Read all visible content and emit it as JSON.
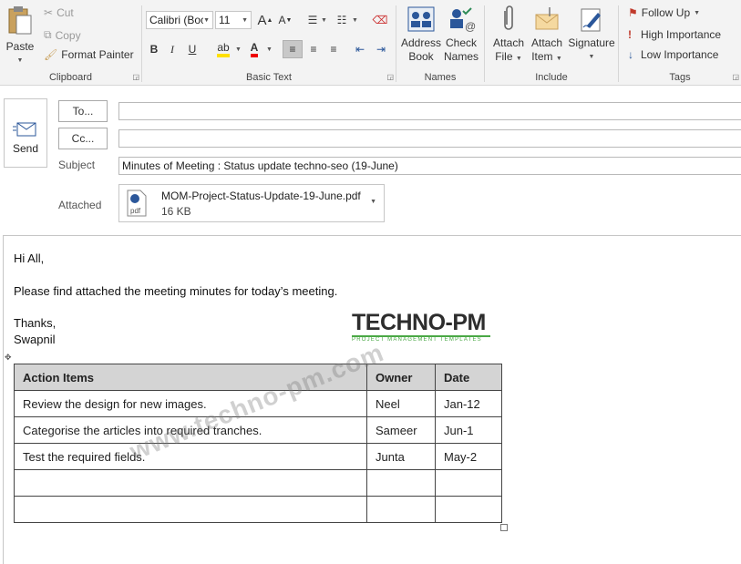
{
  "ribbon": {
    "clipboard": {
      "label": "Clipboard",
      "paste": "Paste",
      "cut": "Cut",
      "copy": "Copy",
      "format_painter": "Format Painter"
    },
    "basic_text": {
      "label": "Basic Text",
      "font": "Calibri (Boc",
      "size": "11"
    },
    "names": {
      "label": "Names",
      "address_book": [
        "Address",
        "Book"
      ],
      "check_names": [
        "Check",
        "Names"
      ]
    },
    "include": {
      "label": "Include",
      "attach_file": [
        "Attach",
        "File"
      ],
      "attach_item": [
        "Attach",
        "Item"
      ],
      "signature": "Signature"
    },
    "tags": {
      "label": "Tags",
      "follow_up": "Follow Up",
      "high_importance": "High Importance",
      "low_importance": "Low Importance"
    }
  },
  "header": {
    "send": "Send",
    "to": "To...",
    "cc": "Cc...",
    "subject_label": "Subject",
    "subject": "Minutes of Meeting : Status update techno-seo (19-June)",
    "attached_label": "Attached",
    "attachment": {
      "name": "MOM-Project-Status-Update-19-June.pdf",
      "size": "16 KB",
      "type": "pdf"
    }
  },
  "body": {
    "greeting": "Hi All,",
    "message": "Please find attached the meeting minutes for today’s meeting.",
    "closing": "Thanks,",
    "signature": "Swapnil",
    "logo": {
      "text": "TECHNO-PM",
      "tagline": "PROJECT MANAGEMENT TEMPLATES"
    },
    "watermark": "www.techno-pm.com",
    "table": {
      "headers": [
        "Action Items",
        "Owner",
        "Date"
      ],
      "rows": [
        [
          "Review the design for new images.",
          "Neel",
          "Jan-12"
        ],
        [
          "Categorise the articles into required tranches.",
          "Sameer",
          "Jun-1"
        ],
        [
          "Test the required fields.",
          "Junta",
          "May-2"
        ],
        [
          "",
          "",
          ""
        ],
        [
          "",
          "",
          ""
        ]
      ]
    }
  },
  "colors": {
    "ribbon_bg": "#f3f3f3",
    "accent": "#2b579a",
    "logo_green": "#4aa845"
  }
}
